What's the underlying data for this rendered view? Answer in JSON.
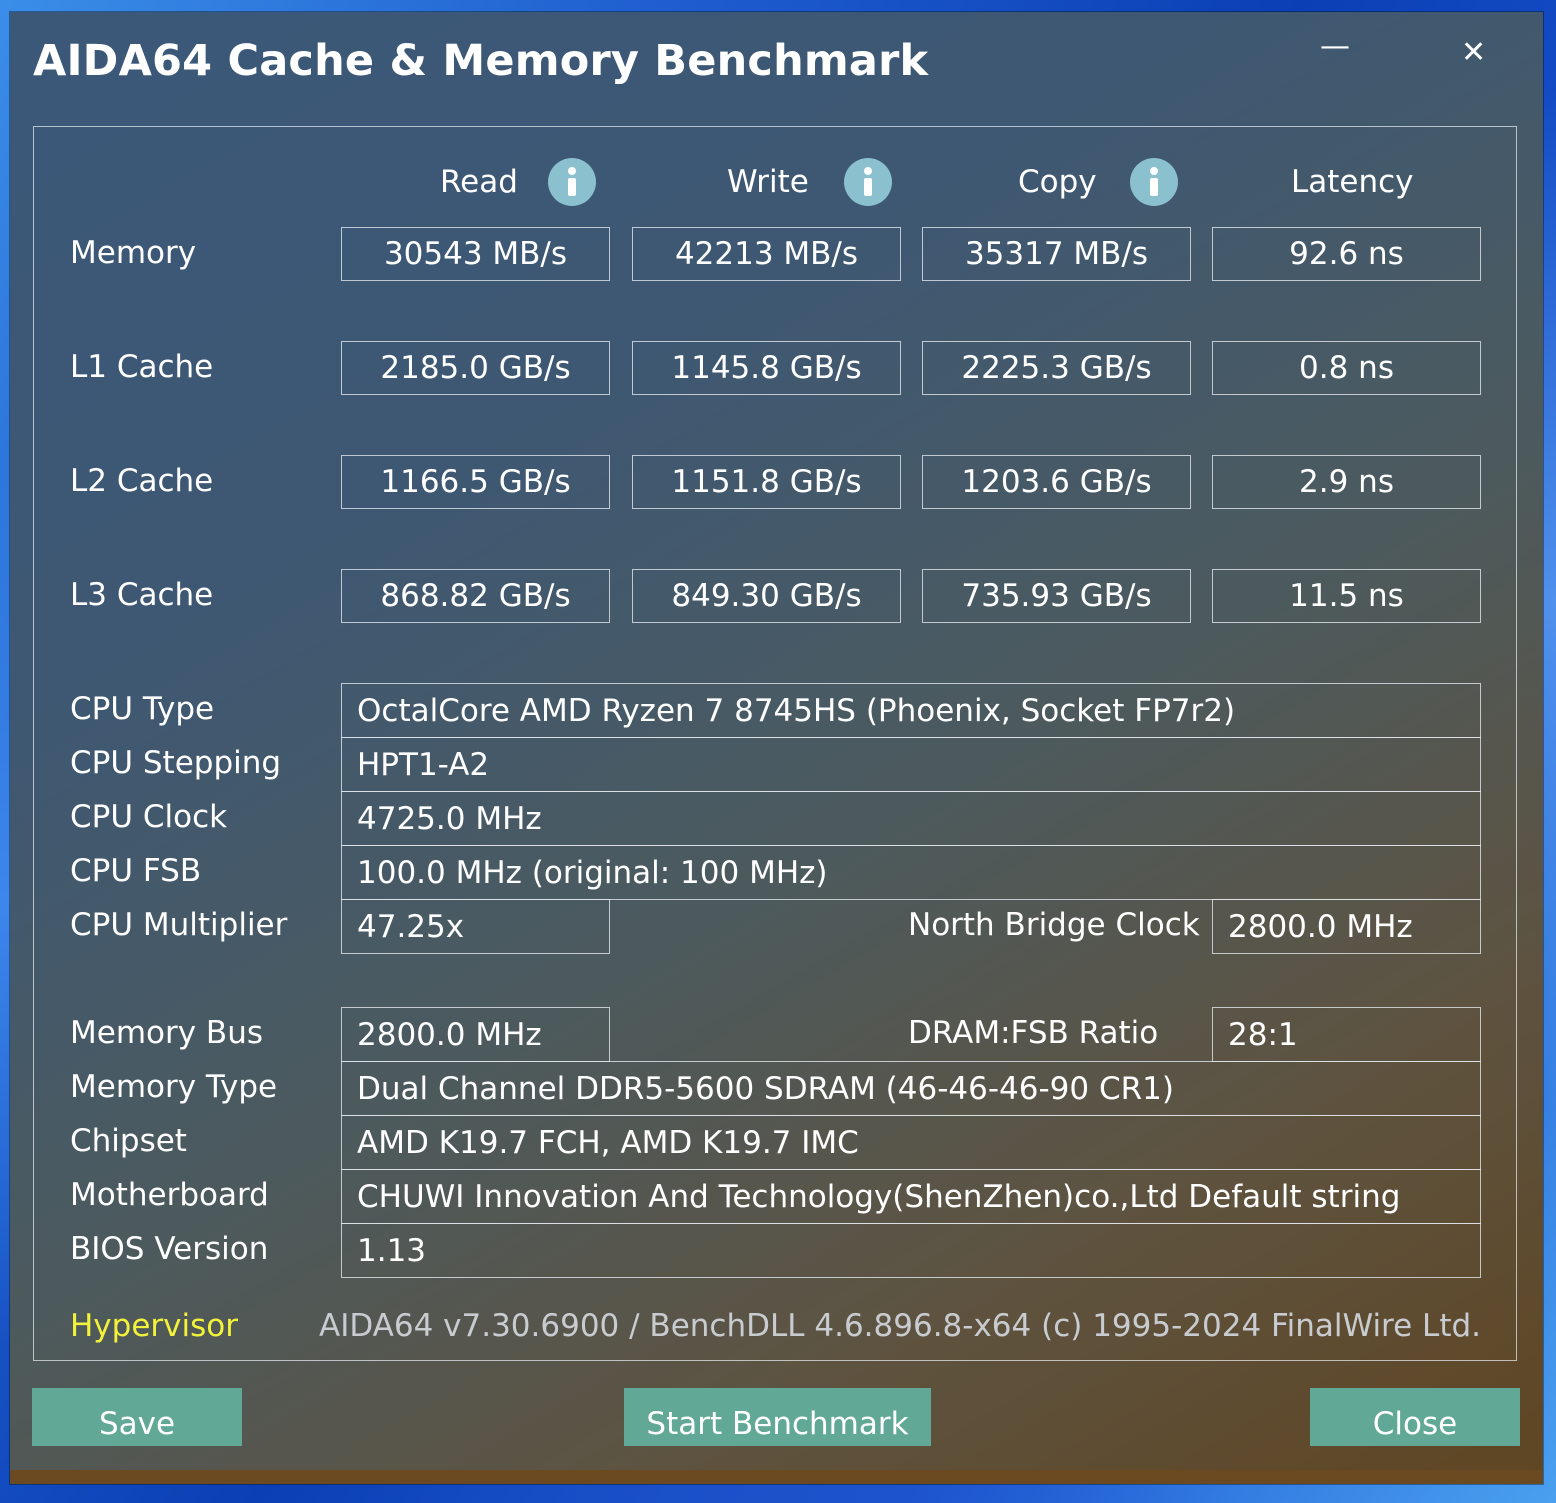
{
  "window": {
    "title": "AIDA64 Cache & Memory Benchmark",
    "minimize_glyph": "—",
    "close_glyph": "✕"
  },
  "columns": {
    "read": "Read",
    "write": "Write",
    "copy": "Copy",
    "latency": "Latency"
  },
  "benchmarks": {
    "memory": {
      "label": "Memory",
      "read": "30543 MB/s",
      "write": "42213 MB/s",
      "copy": "35317 MB/s",
      "latency": "92.6 ns"
    },
    "l1": {
      "label": "L1 Cache",
      "read": "2185.0 GB/s",
      "write": "1145.8 GB/s",
      "copy": "2225.3 GB/s",
      "latency": "0.8 ns"
    },
    "l2": {
      "label": "L2 Cache",
      "read": "1166.5 GB/s",
      "write": "1151.8 GB/s",
      "copy": "1203.6 GB/s",
      "latency": "2.9 ns"
    },
    "l3": {
      "label": "L3 Cache",
      "read": "868.82 GB/s",
      "write": "849.30 GB/s",
      "copy": "735.93 GB/s",
      "latency": "11.5 ns"
    }
  },
  "cpu": {
    "type_label": "CPU Type",
    "type_value": "OctalCore AMD Ryzen 7 8745HS  (Phoenix, Socket FP7r2)",
    "stepping_label": "CPU Stepping",
    "stepping_value": "HPT1-A2",
    "clock_label": "CPU Clock",
    "clock_value": "4725.0 MHz",
    "fsb_label": "CPU FSB",
    "fsb_value": "100.0 MHz  (original: 100 MHz)",
    "multiplier_label": "CPU Multiplier",
    "multiplier_value": "47.25x",
    "nb_clock_label": "North Bridge Clock",
    "nb_clock_value": "2800.0 MHz"
  },
  "memory_info": {
    "bus_label": "Memory Bus",
    "bus_value": "2800.0 MHz",
    "ratio_label": "DRAM:FSB Ratio",
    "ratio_value": "28:1",
    "type_label": "Memory Type",
    "type_value": "Dual Channel DDR5-5600 SDRAM  (46-46-46-90 CR1)",
    "chipset_label": "Chipset",
    "chipset_value": "AMD K19.7 FCH, AMD K19.7 IMC",
    "motherboard_label": "Motherboard",
    "motherboard_value": "CHUWI Innovation And Technology(ShenZhen)co.,Ltd Default string",
    "bios_label": "BIOS Version",
    "bios_value": "1.13"
  },
  "footer": {
    "hypervisor": "Hypervisor",
    "version": "AIDA64 v7.30.6900 / BenchDLL 4.6.896.8-x64  (c) 1995-2024 FinalWire Ltd."
  },
  "buttons": {
    "save": "Save",
    "start": "Start Benchmark",
    "close": "Close"
  },
  "colors": {
    "button_bg": "#62a896",
    "hypervisor": "#f2f23a",
    "info_icon": "#8bc1cf"
  }
}
